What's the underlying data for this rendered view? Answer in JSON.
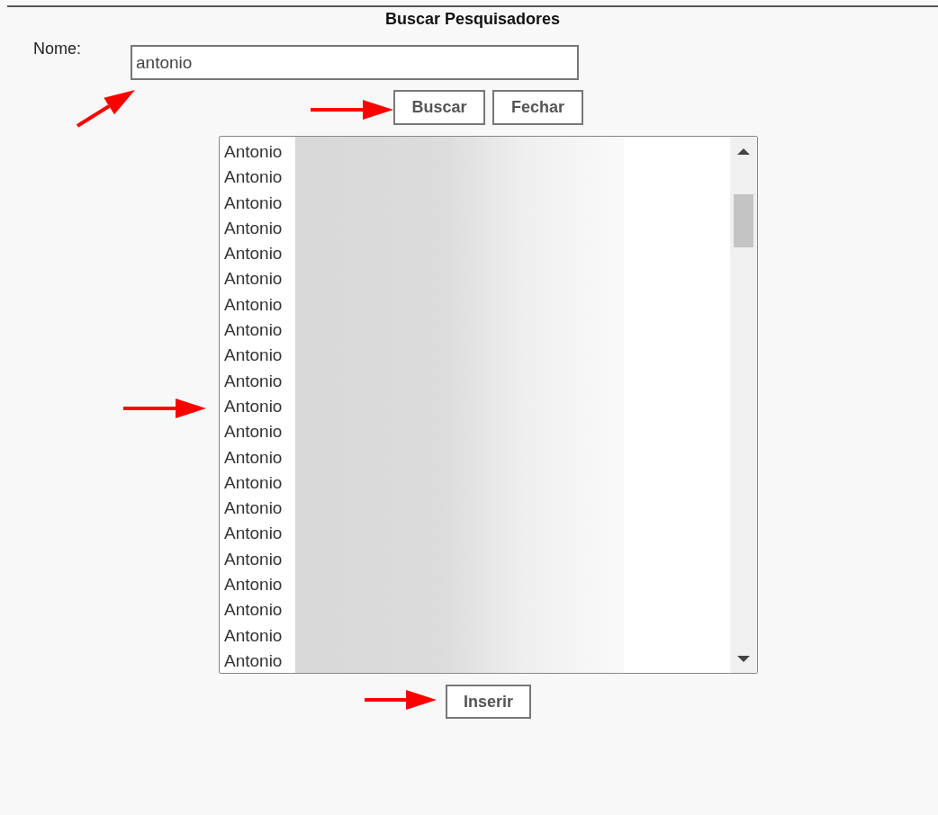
{
  "title": "Buscar Pesquisadores",
  "search": {
    "label": "Nome:",
    "value": "antonio"
  },
  "buttons": [
    "Buscar",
    "Fechar"
  ],
  "results": [
    {
      "name": "Antonio",
      "selected": false
    },
    {
      "name": "Antonio",
      "selected": false
    },
    {
      "name": "Antonio",
      "selected": false
    },
    {
      "name": "Antonio",
      "selected": false
    },
    {
      "name": "Antonio",
      "selected": false
    },
    {
      "name": "Antonio",
      "selected": false
    },
    {
      "name": "Antonio",
      "selected": false
    },
    {
      "name": "Antonio",
      "selected": false
    },
    {
      "name": "Antonio",
      "selected": false
    },
    {
      "name": "Antonio",
      "selected": false
    },
    {
      "name": "Antonio",
      "selected": false
    },
    {
      "name": "Antonio",
      "selected": false
    },
    {
      "name": "Antonio",
      "selected": false
    },
    {
      "name": "Antonio",
      "selected": false
    },
    {
      "name": "Antonio",
      "selected": false
    },
    {
      "name": "Antonio",
      "selected": false
    },
    {
      "name": "Antonio",
      "selected": false
    },
    {
      "name": "Antonio",
      "selected": false
    },
    {
      "name": "Antonio",
      "selected": false
    },
    {
      "name": "Antonio",
      "selected": false
    },
    {
      "name": "Antonio",
      "selected": false
    }
  ],
  "insert_button": "Inserir"
}
